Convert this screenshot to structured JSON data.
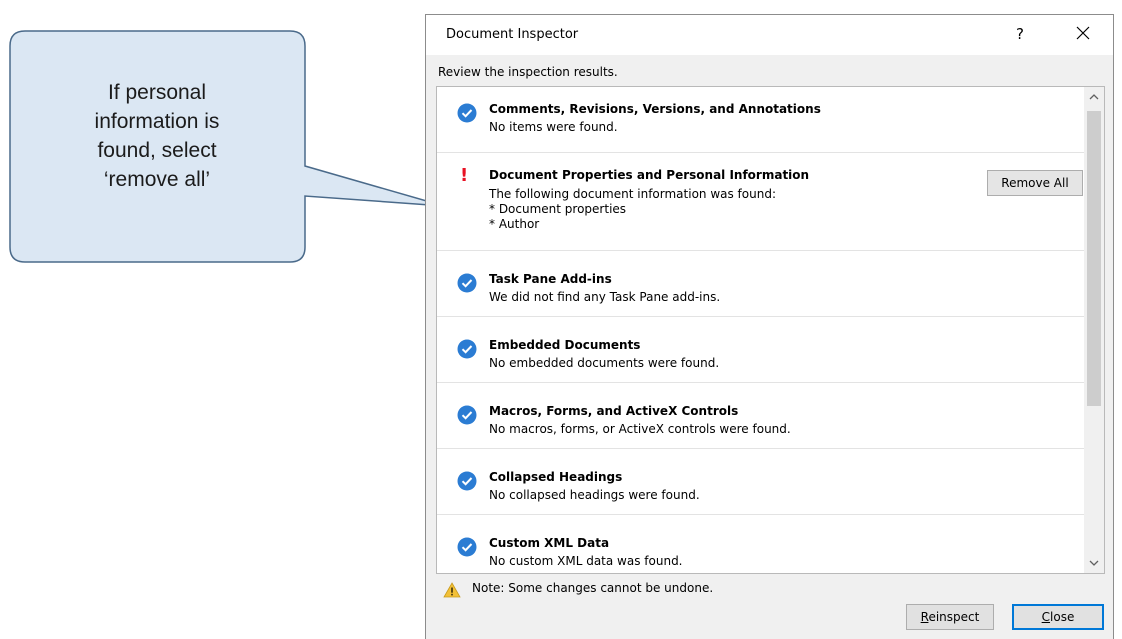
{
  "callout": {
    "lines": [
      "If personal",
      "information is",
      "found, select",
      "‘remove all’"
    ],
    "fill_color": "#dbe7f3",
    "stroke_color": "#4a6a8a"
  },
  "dialog": {
    "title": "Document Inspector",
    "help_label": "?",
    "subtitle": "Review the inspection results.",
    "sections": [
      {
        "status": "ok",
        "icon": "checkmark-icon",
        "heading": "Comments, Revisions, Versions, and Annotations",
        "details": [
          "No items were found."
        ]
      },
      {
        "status": "found",
        "icon": "exclamation-icon",
        "heading": "Document Properties and Personal Information",
        "details": [
          "The following document information was found:",
          "* Document properties",
          "* Author"
        ],
        "action_label": "Remove All"
      },
      {
        "status": "ok",
        "icon": "checkmark-icon",
        "heading": "Task Pane Add-ins",
        "details": [
          "We did not find any Task Pane add-ins."
        ]
      },
      {
        "status": "ok",
        "icon": "checkmark-icon",
        "heading": "Embedded Documents",
        "details": [
          "No embedded documents were found."
        ]
      },
      {
        "status": "ok",
        "icon": "checkmark-icon",
        "heading": "Macros, Forms, and ActiveX Controls",
        "details": [
          "No macros, forms, or ActiveX controls were found."
        ]
      },
      {
        "status": "ok",
        "icon": "checkmark-icon",
        "heading": "Collapsed Headings",
        "details": [
          "No collapsed headings were found."
        ]
      },
      {
        "status": "ok",
        "icon": "checkmark-icon",
        "heading": "Custom XML Data",
        "details": [
          "No custom XML data was found."
        ]
      }
    ],
    "note": "Note: Some changes cannot be undone.",
    "buttons": {
      "reinspect": {
        "mnemonic": "R",
        "rest": "einspect"
      },
      "close": {
        "mnemonic": "C",
        "rest": "lose"
      }
    },
    "colors": {
      "check_blue": "#2b7cd3",
      "warning_red": "#e81123",
      "focus_blue": "#0078d7"
    }
  }
}
